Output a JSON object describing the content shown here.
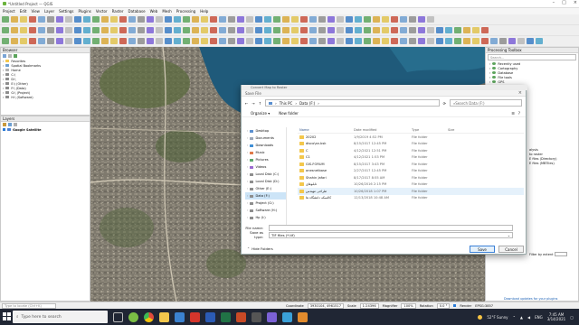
{
  "window": {
    "title": "*Untitled Project — QGIS"
  },
  "menu": [
    "Project",
    "Edit",
    "View",
    "Layer",
    "Settings",
    "Plugins",
    "Vector",
    "Raster",
    "Database",
    "Web",
    "Mesh",
    "Processing",
    "Help"
  ],
  "browser": {
    "title": "Browser",
    "items": [
      "Favorites",
      "Spatial Bookmarks",
      "Home",
      "C:\\",
      "D:\\",
      "E:\\ (Other)",
      "F:\\ (Data)",
      "G:\\ (Project)",
      "H:\\ (Software)"
    ]
  },
  "layers": {
    "title": "Layers",
    "items": [
      {
        "label": "Google Satellite",
        "checked": true
      }
    ]
  },
  "toolbox": {
    "title": "Processing Toolbox",
    "search_placeholder": "Search...",
    "items": [
      "Recently used",
      "Cartography",
      "Database",
      "File tools",
      "GPS"
    ],
    "right_items": [
      "alysis",
      "to raster",
      "E files (Directory)",
      "E files (MBTiles)"
    ],
    "filter_label": "Filter by extent",
    "download_text": "Download updates for your plugins"
  },
  "dialog": {
    "title": "Convert Map to Raster",
    "subtitle": "Save File",
    "nav_back": "←",
    "nav_forward": "→",
    "nav_up": "↑",
    "breadcrumb": [
      "This PC",
      "Data (F:)"
    ],
    "search_placeholder": "Search Data (F:)",
    "organize_label": "Organize ▾",
    "new_folder_label": "New folder",
    "nav_items": [
      "Desktop",
      "Documents",
      "Downloads",
      "Music",
      "Pictures",
      "Videos",
      "Local Disk (C:)",
      "Local Disk (D:)",
      "Other (E:)",
      "Data (F:)",
      "Project (G:)",
      "Software (H:)",
      "Hp (I:)"
    ],
    "nav_selected": 9,
    "columns": [
      "Name",
      "Date modified",
      "Type",
      "Size"
    ],
    "files": [
      {
        "name": "20202",
        "date": "1/9/2019 4:52 PM",
        "type": "File folder",
        "size": ""
      },
      {
        "name": "disco\\an.bsk",
        "date": "8/15/2017 12:45 PM",
        "type": "File folder",
        "size": ""
      },
      {
        "name": "C",
        "date": "4/12/2021 12:51 PM",
        "type": "File folder",
        "size": ""
      },
      {
        "name": "C1",
        "date": "4/12/2021 1:53 PM",
        "type": "File folder",
        "size": ""
      },
      {
        "name": "GIS-FORUM",
        "date": "8/15/2017 3:43 PM",
        "type": "File folder",
        "size": ""
      },
      {
        "name": "onesnetbase",
        "date": "2/27/2017 12:45 PM",
        "type": "File folder",
        "size": ""
      },
      {
        "name": "Shahin Jafari",
        "date": "8/17/2017 8:55 AM",
        "type": "File folder",
        "size": ""
      },
      {
        "name": "تابلوهای",
        "date": "10/26/2016 2:15 PM",
        "type": "File folder",
        "size": ""
      },
      {
        "name": "طراحی مهندس",
        "date": "10/26/2018 1:07 PM",
        "type": "File folder",
        "size": ""
      },
      {
        "name": "کالسکه دانشگاه ها",
        "date": "12/13/2018 10:48 AM",
        "type": "File folder",
        "size": ""
      }
    ],
    "highlighted_row": 8,
    "file_name_label": "File name:",
    "file_name_value": "",
    "save_type_label": "Save as type:",
    "save_type_value": "TIF files (*.tif)",
    "hide_folders_label": "Hide Folders",
    "save_label": "Save",
    "cancel_label": "Cancel"
  },
  "statusbar": {
    "locate_placeholder": "Type to locate (Ctrl+K)",
    "coord_label": "Coordinate",
    "coord_value": "3930104, 4961517",
    "scale_label": "Scale",
    "scale_value": "1:24396",
    "magnifier_label": "Magnifier",
    "magnifier_value": "100%",
    "rotation_label": "Rotation",
    "rotation_value": "0.0 °",
    "render_label": "Render",
    "crs_label": "EPSG:3857"
  },
  "taskbar": {
    "search_placeholder": "Type here to search",
    "weather": "52°F Sunny",
    "lang": "ENG",
    "time": "7:45 AM",
    "date": "3/14/2021"
  },
  "colors": {
    "accent": "#2a7bd6",
    "water": "#1f5a7a",
    "taskbar": "#202634"
  }
}
